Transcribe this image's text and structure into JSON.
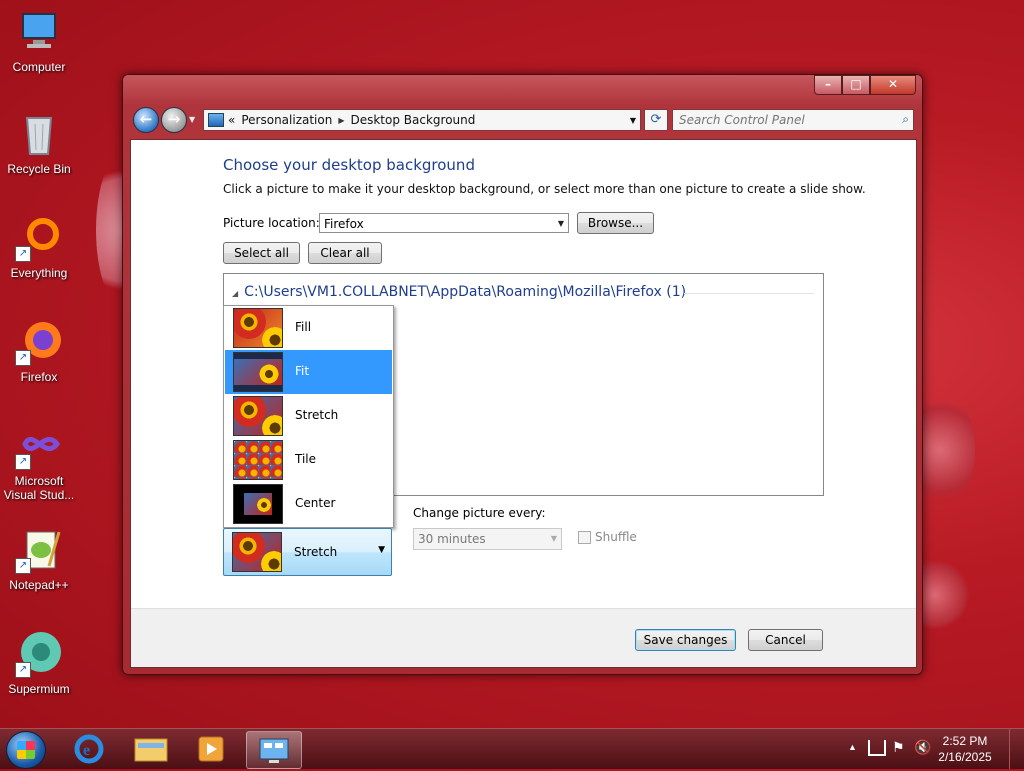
{
  "desktop": {
    "icons": [
      {
        "label": "Computer",
        "icon": "computer-icon"
      },
      {
        "label": "Recycle Bin",
        "icon": "recycle-bin-icon"
      },
      {
        "label": "Everything",
        "icon": "everything-icon"
      },
      {
        "label": "Firefox",
        "icon": "firefox-icon"
      },
      {
        "label": "Microsoft Visual Stud...",
        "icon": "visual-studio-icon"
      },
      {
        "label": "Notepad++",
        "icon": "notepadpp-icon"
      },
      {
        "label": "Supermium",
        "icon": "supermium-icon"
      }
    ]
  },
  "window": {
    "caption_buttons": {
      "minimize": "–",
      "maximize": "□",
      "close": "✕"
    },
    "address": {
      "overflow": "«",
      "crumbs": [
        "Personalization",
        "Desktop Background"
      ]
    },
    "search": {
      "placeholder": "Search Control Panel"
    },
    "heading": "Choose your desktop background",
    "subheading": "Click a picture to make it your desktop background, or select more than one picture to create a slide show.",
    "picture_location_label": "Picture location:",
    "picture_location_value": "Firefox",
    "browse_label": "Browse...",
    "select_all_label": "Select all",
    "clear_all_label": "Clear all",
    "group_header": "C:\\Users\\VM1.COLLABNET\\AppData\\Roaming\\Mozilla\\Firefox (1)",
    "position_options": [
      {
        "label": "Fill"
      },
      {
        "label": "Fit"
      },
      {
        "label": "Stretch"
      },
      {
        "label": "Tile"
      },
      {
        "label": "Center"
      }
    ],
    "position_highlighted": "Fit",
    "position_selected": "Stretch",
    "change_picture_label": "Change picture every:",
    "interval_value": "30 minutes",
    "shuffle_label": "Shuffle",
    "save_label": "Save changes",
    "cancel_label": "Cancel"
  },
  "taskbar": {
    "time": "2:52 PM",
    "date": "2/16/2025"
  },
  "colors": {
    "desktop": "#b81a24",
    "selection": "#3399ff",
    "heading": "#1e3e8e"
  }
}
